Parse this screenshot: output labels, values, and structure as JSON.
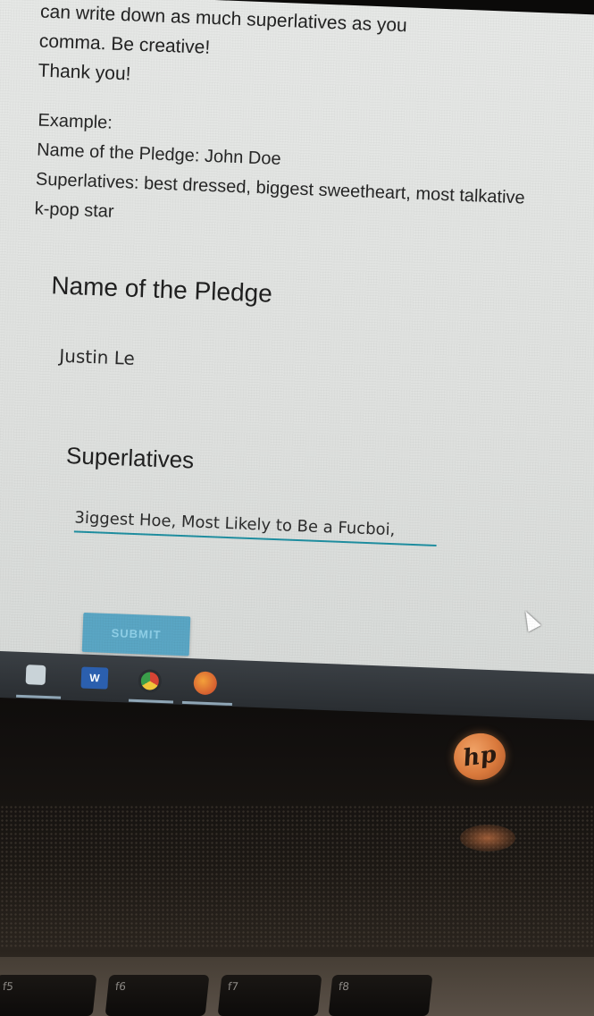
{
  "form": {
    "intro_line1": "can write down as much superlatives as you",
    "intro_line2": "comma. Be creative!",
    "intro_line3": "Thank you!",
    "example_heading": "Example:",
    "example_name": "Name of the Pledge: John Doe",
    "example_superlatives": "Superlatives: best dressed, biggest sweetheart, most talkative",
    "example_superlatives_cont": "k-pop star",
    "name_field": {
      "title": "Name of the Pledge",
      "value": "Justin Le"
    },
    "superlatives_field": {
      "title": "Superlatives",
      "value": "3iggest Hoe, Most Likely to Be a Fucboi,"
    },
    "submit_label": "SUBMIT"
  },
  "taskbar": {
    "icons": [
      "search-icon",
      "word-icon",
      "chrome-icon",
      "firefox-icon"
    ],
    "word_letter": "W"
  },
  "laptop": {
    "logo_text": "hp",
    "function_keys": [
      {
        "key": "f5"
      },
      {
        "key": "f6"
      },
      {
        "key": "f7"
      },
      {
        "key": "f8"
      }
    ]
  },
  "colors": {
    "accent_underline": "#1f8fa1",
    "submit_button": "#5aa6c4",
    "hp_logo": "#d9793c"
  }
}
